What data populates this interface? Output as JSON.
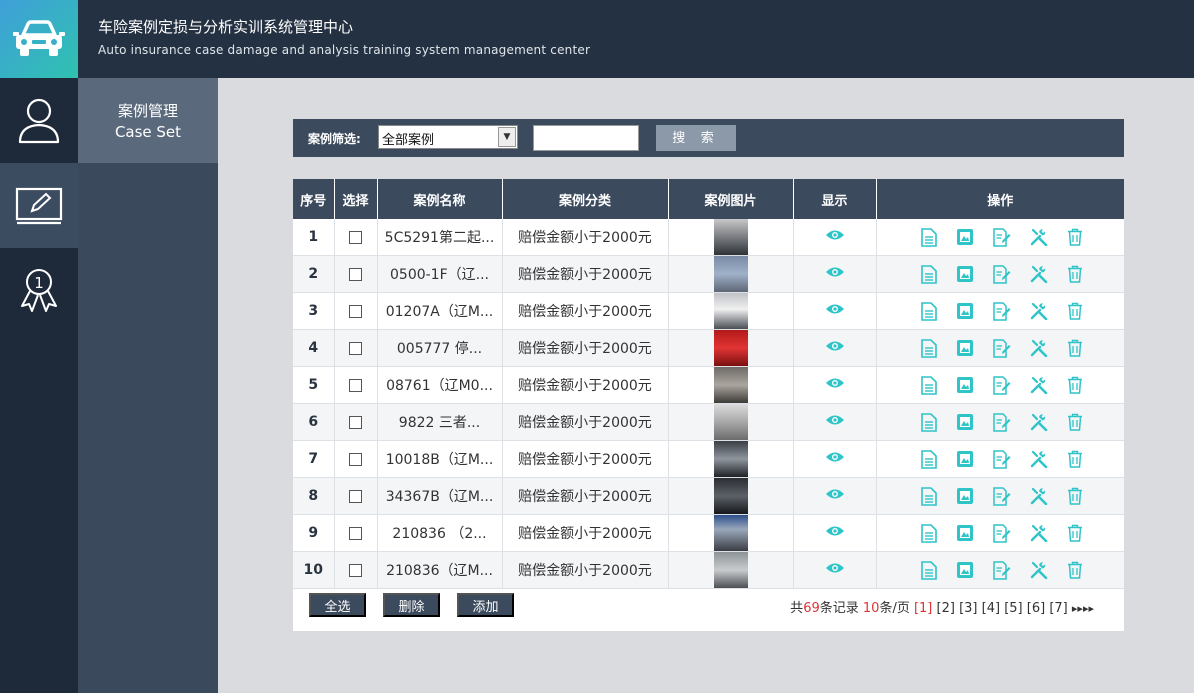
{
  "header": {
    "title_cn": "车险案例定损与分析实训系统管理中心",
    "title_en": "Auto insurance case damage and analysis training system management center"
  },
  "sidebar": {
    "menu_cn": "案例管理",
    "menu_en": "Case Set"
  },
  "filter": {
    "label": "案例筛选:",
    "selected": "全部案例",
    "search_value": "",
    "search_button": "搜 索"
  },
  "table": {
    "columns": [
      "序号",
      "选择",
      "案例名称",
      "案例分类",
      "案例图片",
      "显示",
      "操作"
    ],
    "rows": [
      {
        "no": "1",
        "name": "5C5291第二起...",
        "category": "赔偿金额小于2000元"
      },
      {
        "no": "2",
        "name": "0500-1F（辽...",
        "category": "赔偿金额小于2000元"
      },
      {
        "no": "3",
        "name": "01207A（辽M...",
        "category": "赔偿金额小于2000元"
      },
      {
        "no": "4",
        "name": "005777 停...",
        "category": "赔偿金额小于2000元"
      },
      {
        "no": "5",
        "name": "08761（辽M0...",
        "category": "赔偿金额小于2000元"
      },
      {
        "no": "6",
        "name": "9822 三者...",
        "category": "赔偿金额小于2000元"
      },
      {
        "no": "7",
        "name": "10018B（辽M...",
        "category": "赔偿金额小于2000元"
      },
      {
        "no": "8",
        "name": "34367B（辽M...",
        "category": "赔偿金额小于2000元"
      },
      {
        "no": "9",
        "name": "210836 （2...",
        "category": "赔偿金额小于2000元"
      },
      {
        "no": "10",
        "name": "210836（辽M...",
        "category": "赔偿金额小于2000元"
      }
    ]
  },
  "footer": {
    "select_all": "全选",
    "delete": "删除",
    "add": "添加",
    "total_prefix": "共",
    "total": "69",
    "total_suffix": "条记录",
    "per_page": "10",
    "per_page_suffix": "条/页",
    "pages": [
      "[1]",
      "[2]",
      "[3]",
      "[4]",
      "[5]",
      "[6]",
      "[7]"
    ],
    "next": "▸▸",
    "last": "▸▸|"
  },
  "colors": {
    "accent": "#2ec4c8",
    "header": "#243142",
    "bar": "#3b4a5d"
  }
}
